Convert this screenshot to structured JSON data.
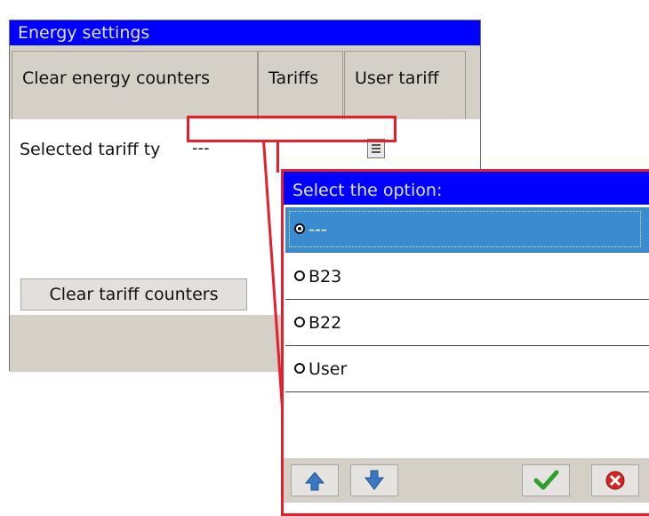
{
  "energy_window": {
    "title": "Energy settings",
    "tabs": [
      {
        "label": "Clear energy counters"
      },
      {
        "label": "Tariffs"
      },
      {
        "label": "User tariff"
      }
    ],
    "tariff_field": {
      "label": "Selected tariff ty",
      "value": "---",
      "list_icon": "list-icon"
    },
    "clear_tariff_button": "Clear tariff counters"
  },
  "option_dialog": {
    "title": "Select the option:",
    "options": [
      {
        "label": "---",
        "selected": true
      },
      {
        "label": "B23",
        "selected": false
      },
      {
        "label": "B22",
        "selected": false
      },
      {
        "label": "User",
        "selected": false
      }
    ],
    "buttons": {
      "up_icon": "arrow-up-icon",
      "down_icon": "arrow-down-icon",
      "ok_icon": "checkmark-icon",
      "cancel_icon": "cancel-icon"
    }
  },
  "colors": {
    "title_bar": "#0000ff",
    "highlight": "#e3202c",
    "selection": "#3a8bd0",
    "chrome": "#d4d0c8"
  }
}
